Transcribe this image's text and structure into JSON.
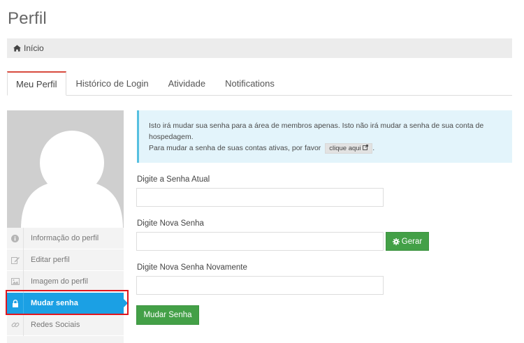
{
  "page": {
    "title": "Perfil"
  },
  "breadcrumb": {
    "home_label": "Início",
    "icon": "home-icon"
  },
  "tabs": [
    {
      "label": "Meu Perfil",
      "active": true
    },
    {
      "label": "Histórico de Login",
      "active": false
    },
    {
      "label": "Atividade",
      "active": false
    },
    {
      "label": "Notifications",
      "active": false
    }
  ],
  "sidebar": {
    "avatar_icon": "user-silhouette-icon",
    "items": [
      {
        "label": "Informação do perfil",
        "icon": "info-icon",
        "active": false
      },
      {
        "label": "Editar perfil",
        "icon": "edit-icon",
        "active": false
      },
      {
        "label": "Imagem do perfil",
        "icon": "image-icon",
        "active": false
      },
      {
        "label": "Mudar senha",
        "icon": "lock-icon",
        "active": true
      },
      {
        "label": "Redes Sociais",
        "icon": "link-icon",
        "active": false
      }
    ]
  },
  "info": {
    "line1": "Isto irá mudar sua senha para a área de membros apenas. Isto não irá mudar a senha de sua conta de hospedagem.",
    "line2_prefix": "Para mudar a senha de suas contas ativas, por favor",
    "link_label": "clique aqui",
    "link_icon": "external-link-icon",
    "line2_suffix": "."
  },
  "form": {
    "current_password_label": "Digite a Senha Atual",
    "current_password_value": "",
    "new_password_label": "Digite Nova Senha",
    "new_password_value": "",
    "generate_label": "Gerar",
    "generate_icon": "gear-icon",
    "confirm_password_label": "Digite Nova Senha Novamente",
    "confirm_password_value": "",
    "submit_label": "Mudar Senha"
  },
  "colors": {
    "tab_accent": "#d84b3e",
    "active_menu": "#1ba0e4",
    "info_bg": "#e3f4fb",
    "info_border": "#56c0e0",
    "button_green": "#43a047",
    "highlight": "#e0161e"
  }
}
